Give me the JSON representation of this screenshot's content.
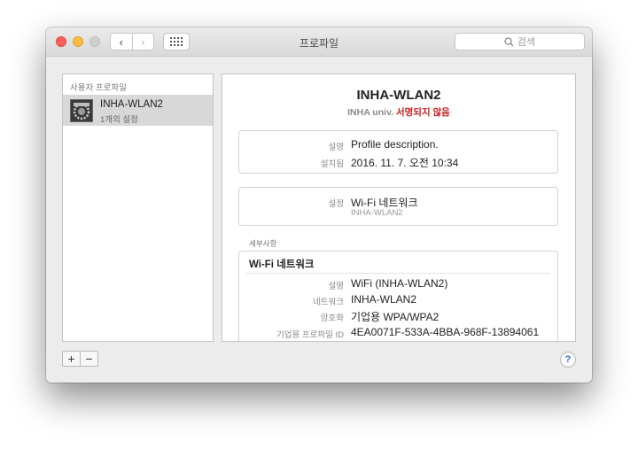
{
  "window": {
    "title": "프로파일",
    "search_placeholder": "검색",
    "nav_back": "‹",
    "nav_forward": "›"
  },
  "sidebar": {
    "header": "사용자 프로파일",
    "items": [
      {
        "name": "INHA-WLAN2",
        "subtitle": "1개의 설정"
      }
    ]
  },
  "detail": {
    "title": "INHA-WLAN2",
    "org": "INHA univ.",
    "signature_status": "서명되지 않음",
    "summary": [
      {
        "label": "설명",
        "value": "Profile description."
      },
      {
        "label": "설치됨",
        "value": "2016. 11. 7. 오전 10:34"
      }
    ],
    "settings": {
      "label": "설정",
      "value": "Wi-Fi 네트워크",
      "subvalue": "INHA-WLAN2"
    },
    "details_section": "세부사항",
    "wifi": {
      "header": "Wi-Fi 네트워크",
      "rows": [
        {
          "label": "설명",
          "value": "WiFi (INHA-WLAN2)"
        },
        {
          "label": "네트워크",
          "value": "INHA-WLAN2"
        },
        {
          "label": "암호화",
          "value": "기업용 WPA/WPA2"
        },
        {
          "label": "기업용 프로파일 ID",
          "value": "4EA0071F-533A-4BBA-968F-13894061"
        }
      ]
    }
  },
  "footer": {
    "add": "+",
    "remove": "−",
    "help": "?"
  },
  "colors": {
    "unsigned": "#cc1f1f",
    "close": "#fc605c",
    "minimize": "#fdbc40",
    "help_accent": "#2a6ee0"
  }
}
